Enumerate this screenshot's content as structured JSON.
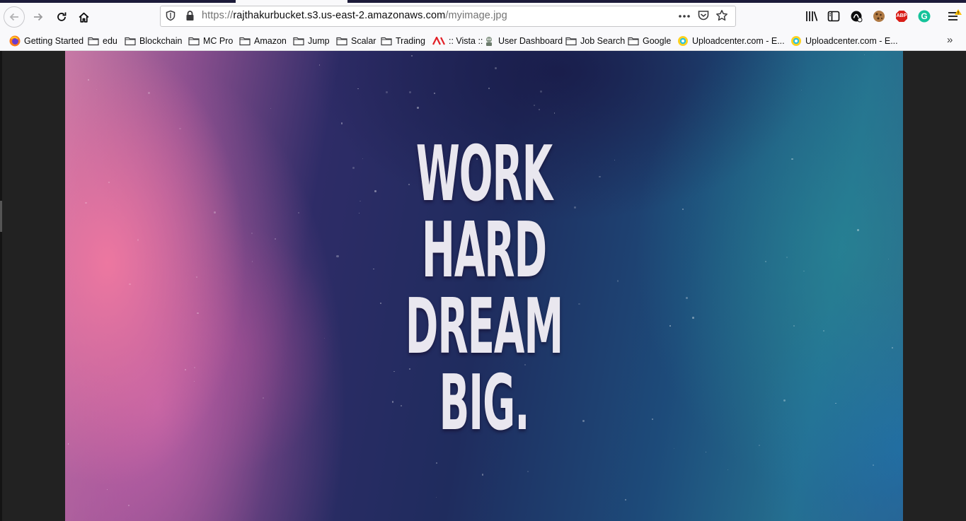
{
  "browser": {
    "url": {
      "scheme": "https://",
      "domain": "rajthakurbucket.s3.us-east-2.amazonaws.com",
      "path": "/myimage.jpg"
    },
    "icons": {
      "back": "back-arrow-icon",
      "forward": "forward-arrow-icon",
      "reload": "reload-icon",
      "home": "home-icon",
      "tracking": "shield-icon",
      "secure": "lock-icon",
      "page_actions": "more-dots-icon",
      "pocket": "pocket-icon",
      "bookmark": "star-icon",
      "library": "library-icon",
      "sidebar": "sidebar-icon",
      "extension_1": "extension-icon",
      "cookie": "cookie-icon",
      "adblock": "adblock-icon",
      "grammarly": "grammarly-icon",
      "menu": "hamburger-menu-icon"
    },
    "extension_labels": {
      "adblock": "ABP",
      "grammarly": "G"
    }
  },
  "bookmarks": [
    {
      "label": "Getting Started",
      "icon": "firefox-icon"
    },
    {
      "label": "edu",
      "icon": "folder-icon"
    },
    {
      "label": "Blockchain",
      "icon": "folder-icon"
    },
    {
      "label": "MC Pro",
      "icon": "folder-icon"
    },
    {
      "label": "Amazon",
      "icon": "folder-icon"
    },
    {
      "label": "Jump",
      "icon": "folder-icon"
    },
    {
      "label": "Scalar",
      "icon": "folder-icon"
    },
    {
      "label": "Trading",
      "icon": "folder-icon"
    },
    {
      "label": ":: Vista ::",
      "icon": "adp-icon"
    },
    {
      "label": "User Dashboard",
      "icon": "robot-icon"
    },
    {
      "label": "Job Search",
      "icon": "folder-icon"
    },
    {
      "label": "Google",
      "icon": "folder-icon"
    },
    {
      "label": "Uploadcenter.com - E...",
      "icon": "uploadcenter-icon"
    },
    {
      "label": "Uploadcenter.com - E...",
      "icon": "uploadcenter-icon"
    }
  ],
  "bookmarks_overflow": "»",
  "image": {
    "lines": [
      "WORK",
      "HARD",
      "DREAM",
      "BIG."
    ],
    "colors": {
      "text": "#e9e7ef",
      "left_pink": "#c77aa6",
      "navy": "#1f2c5e",
      "teal": "#25708f"
    }
  }
}
